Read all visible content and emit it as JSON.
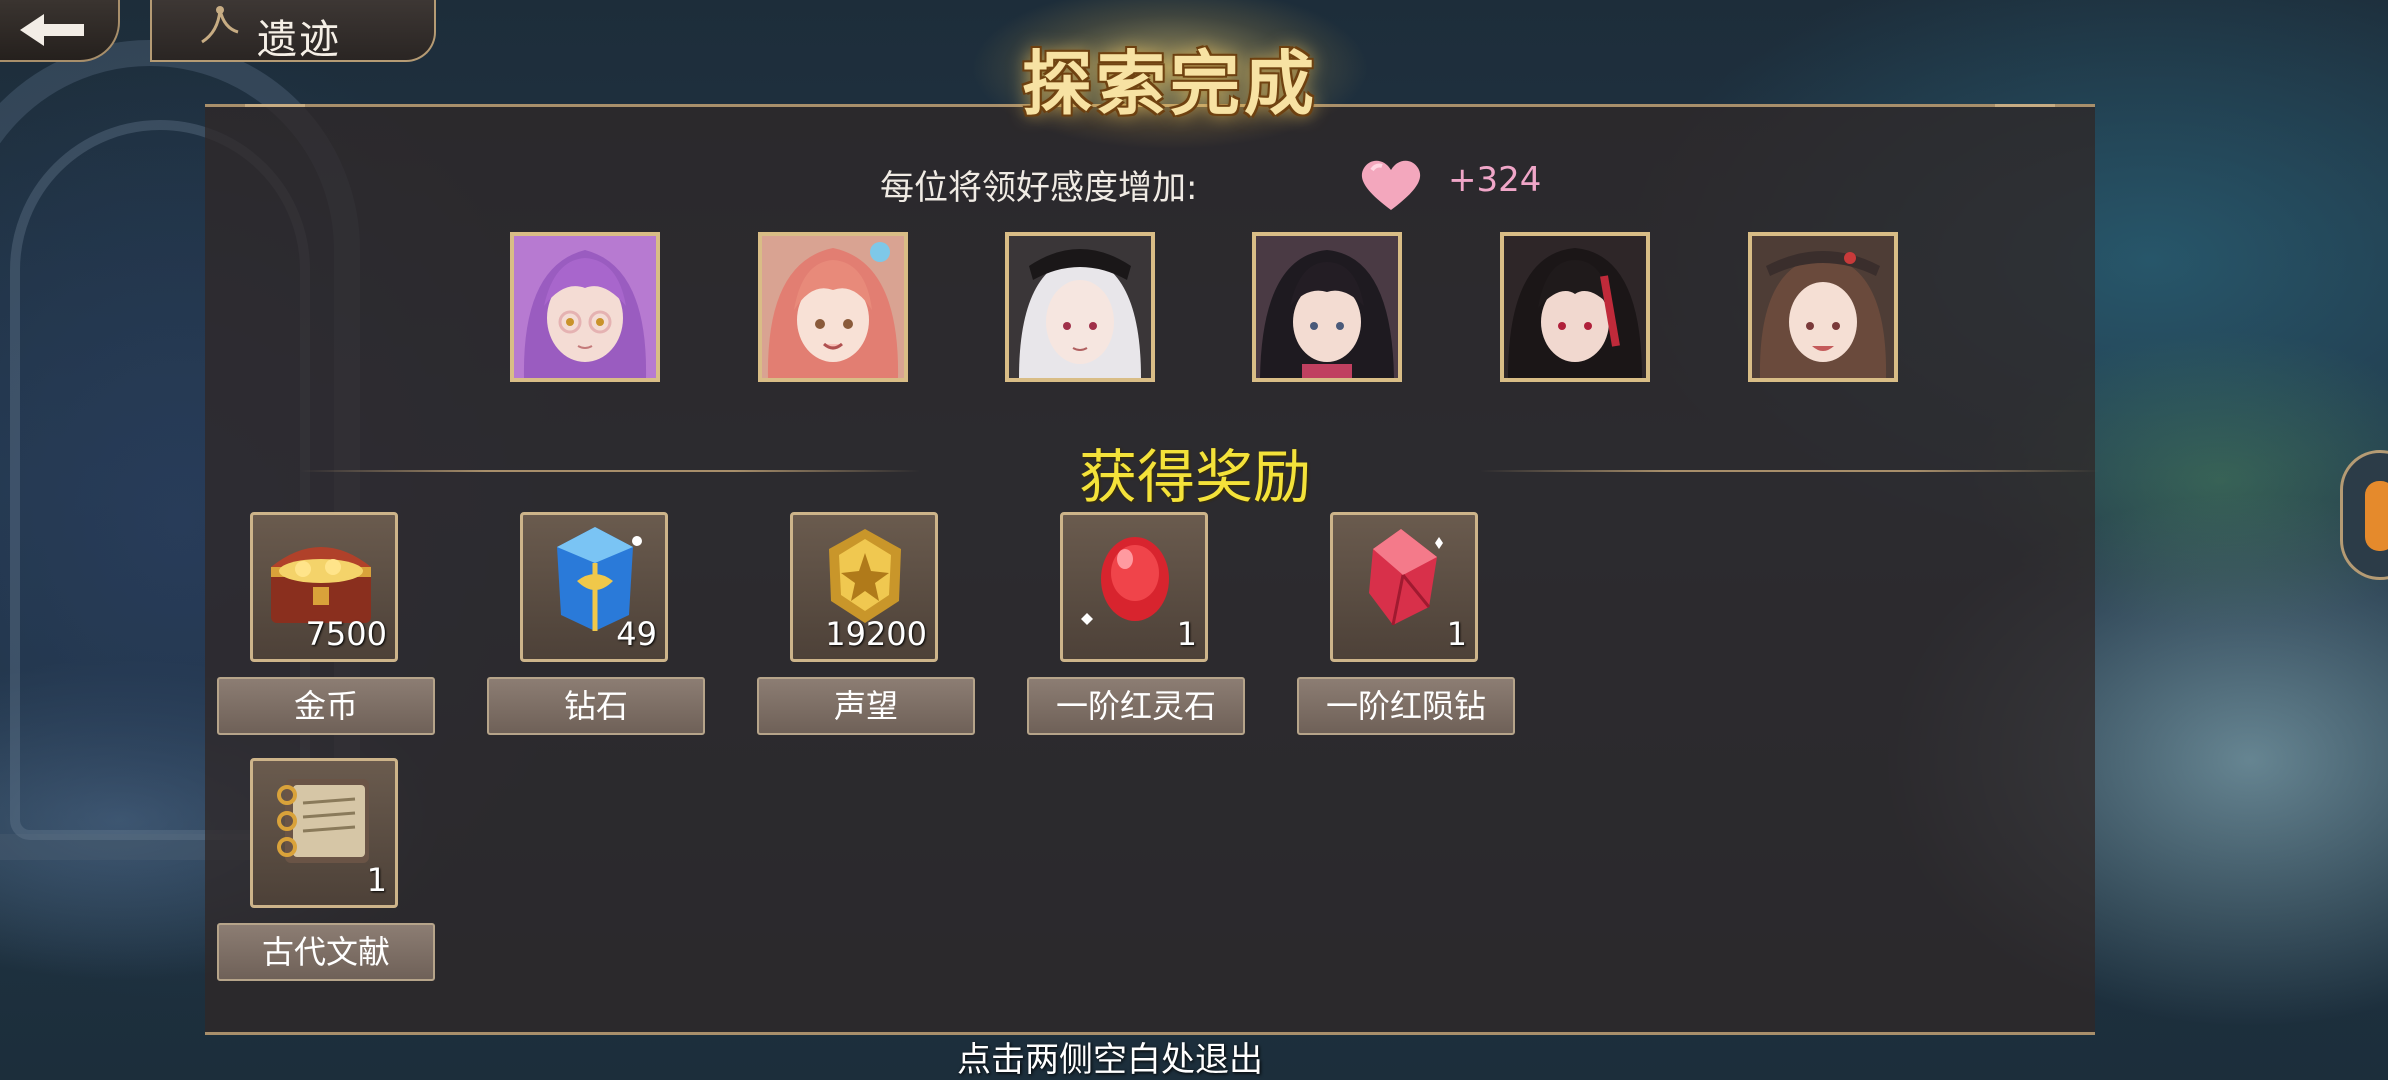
{
  "top_bar": {
    "title": "遗迹"
  },
  "header": {
    "title": "探索完成",
    "affinity_label": "每位将领好感度增加:",
    "affinity_value": "+324"
  },
  "portraits": [
    {
      "name": "portrait-1"
    },
    {
      "name": "portrait-2"
    },
    {
      "name": "portrait-3"
    },
    {
      "name": "portrait-4"
    },
    {
      "name": "portrait-5"
    },
    {
      "name": "portrait-6"
    }
  ],
  "rewards": {
    "title": "获得奖励",
    "items": [
      {
        "label": "金币",
        "count": "7500",
        "icon": "treasure-chest-icon"
      },
      {
        "label": "钻石",
        "count": "49",
        "icon": "diamond-crystal-icon"
      },
      {
        "label": "声望",
        "count": "19200",
        "icon": "gold-badge-icon"
      },
      {
        "label": "一阶红灵石",
        "count": "1",
        "icon": "red-gem-icon"
      },
      {
        "label": "一阶红陨钻",
        "count": "1",
        "icon": "red-crystal-icon"
      },
      {
        "label": "古代文献",
        "count": "1",
        "icon": "ancient-book-icon"
      }
    ]
  },
  "footer": {
    "hint": "点击两侧空白处退出"
  },
  "colors": {
    "gold_title": "#f7e2a3",
    "rewards_title": "#f4e23a",
    "affinity_value": "#f0a6c8",
    "frame": "#cdb48a"
  }
}
